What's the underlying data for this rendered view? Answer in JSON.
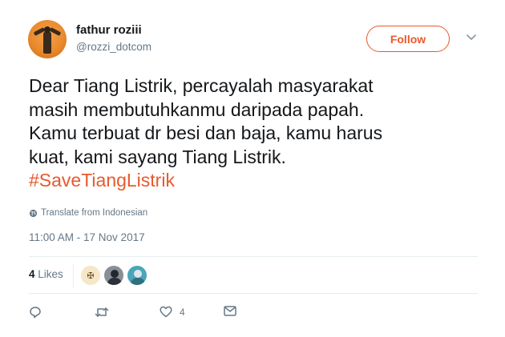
{
  "user": {
    "name": "fathur roziii",
    "handle": "@rozzi_dotcom"
  },
  "follow_button": {
    "label": "Follow"
  },
  "tweet": {
    "lines": [
      "Dear Tiang Listrik, percayalah masyarakat",
      "masih membutuhkanmu daripada papah.",
      "Kamu terbuat dr besi dan baja, kamu harus",
      "kuat, kami sayang Tiang Listrik."
    ],
    "hashtag": "#SaveTiangListrik"
  },
  "translate_label": "Translate from Indonesian",
  "timestamp": "11:00 AM - 17 Nov 2017",
  "likes": {
    "count": "4",
    "label": "Likes"
  },
  "actions": {
    "like_count": "4"
  },
  "icons": {
    "chevron": "chevron-down-icon",
    "globe": "globe-icon",
    "reply": "reply-icon",
    "retweet": "retweet-icon",
    "like": "heart-icon",
    "message": "envelope-icon"
  },
  "colors": {
    "accent": "#e8592d",
    "secondary_text": "#657786",
    "primary_text": "#14171a"
  }
}
